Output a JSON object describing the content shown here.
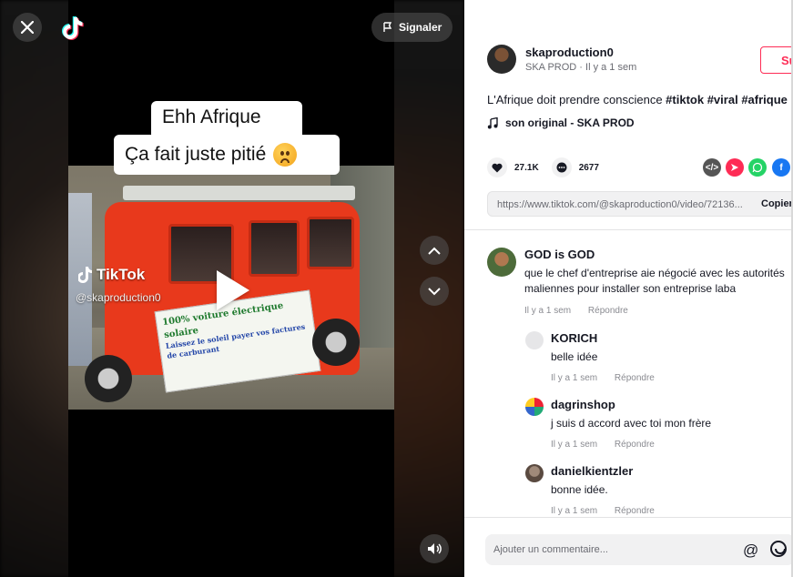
{
  "video": {
    "caption_line1": "Ehh Afrique",
    "caption_line2": "Ça fait juste pitié",
    "watermark_brand": "TikTok",
    "watermark_user": "@skaproduction0",
    "banner_line1": "100% voiture électrique solaire",
    "banner_line2": "Laissez le soleil payer vos factures de carburant",
    "report_label": "Signaler"
  },
  "author": {
    "username": "skaproduction0",
    "subtitle": "SKA PROD · Il y a 1 sem",
    "follow_label": "Su"
  },
  "post": {
    "description": "L'Afrique doit prendre conscience",
    "hashtags": [
      "#tiktok",
      "#viral",
      "#afrique"
    ],
    "music": "son original - SKA PROD",
    "likes": "27.1K",
    "comments_count": "2677",
    "link": "https://www.tiktok.com/@skaproduction0/video/72136...",
    "copy_label": "Copier"
  },
  "comments": [
    {
      "name": "GOD is GOD",
      "text": "que le chef d'entreprise aie négocié avec les autorités maliennes pour installer son entreprise laba",
      "time": "Il y a 1 sem",
      "reply_label": "Répondre"
    }
  ],
  "replies": [
    {
      "name": "KORICH",
      "text": "belle idée",
      "time": "Il y a 1 sem",
      "reply_label": "Répondre"
    },
    {
      "name": "dagrinshop",
      "text": "j suis d accord avec toi mon frère",
      "time": "Il y a 1 sem",
      "reply_label": "Répondre"
    },
    {
      "name": "danielkientzler",
      "text": "bonne idée.",
      "time": "Il y a 1 sem",
      "reply_label": "Répondre"
    }
  ],
  "composer": {
    "placeholder": "Ajouter un commentaire..."
  },
  "colors": {
    "accent": "#fe2c55",
    "whatsapp": "#25d366",
    "facebook": "#1877f2"
  }
}
